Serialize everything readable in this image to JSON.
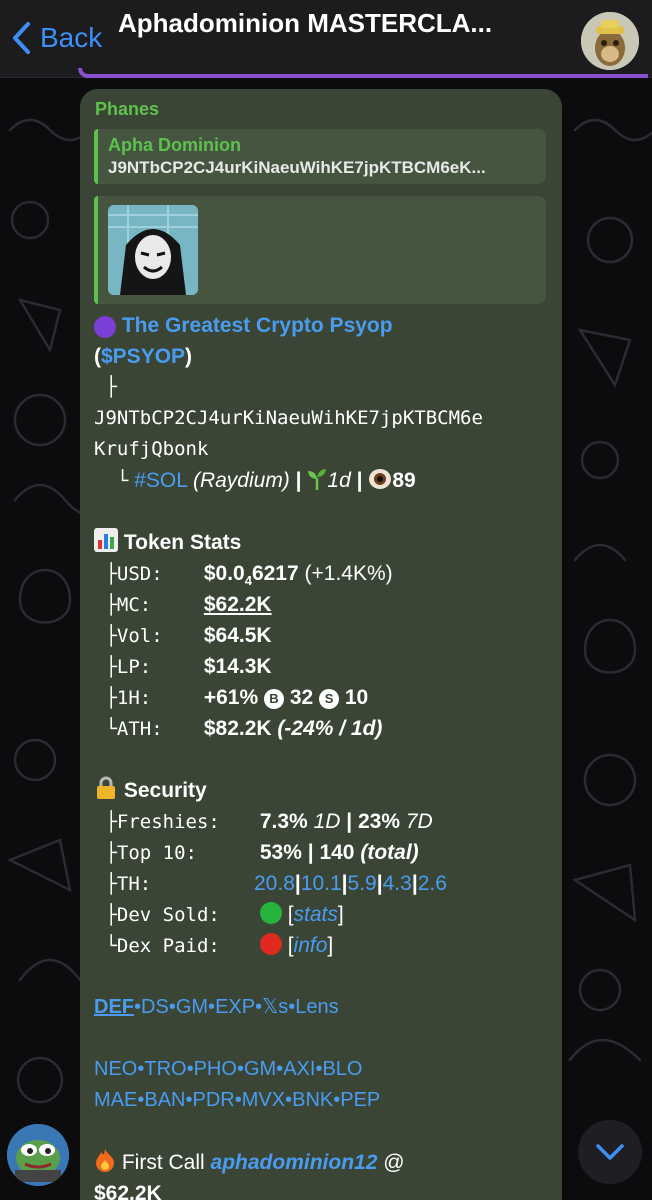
{
  "header": {
    "back_label": "Back",
    "title": "Aphadominion MASTERCLA..."
  },
  "message": {
    "sender": "Phanes",
    "reply": {
      "name": "Apha Dominion",
      "text": "J9NTbCP2CJ4urKiNaeuWihKE7jpKTBCM6eK..."
    },
    "token_title": "The Greatest Crypto Psyop",
    "ticker_open": "(",
    "ticker": "$PSYOP",
    "ticker_close": ")",
    "branch_tee": "├",
    "address_line1": "J9NTbCP2CJ4urKiNaeuWihKE7jpKTBCM6e",
    "address_line2": "KrufjQbonk",
    "branch_end": "└",
    "chain_tag": "#SOL",
    "dex": "(Raydium)",
    "sep": "|",
    "age": "1d",
    "views": "89",
    "stats": {
      "heading": "Token Stats",
      "usd_key": "├USD:",
      "usd_val_a": "$0.0",
      "usd_val_sub": "4",
      "usd_val_b": "6217",
      "usd_change": "(+1.4K%)",
      "mc_key": "├MC:",
      "mc_val": "$62.2K",
      "vol_key": "├Vol:",
      "vol_val": "$64.5K",
      "lp_key": "├LP:",
      "lp_val": "$14.3K",
      "h1_key": "├1H:",
      "h1_val": "+61%",
      "buy_icon": "B",
      "buys": "32",
      "sell_icon": "S",
      "sells": "10",
      "ath_key": "└ATH:",
      "ath_val": "$82.2K",
      "ath_change": "(-24% / 1d)"
    },
    "security": {
      "heading": "Security",
      "freshies_key": "├Freshies:",
      "freshies_1d": "7.3%",
      "freshies_1d_label": "1D",
      "sep": "|",
      "freshies_7d": "23%",
      "freshies_7d_label": "7D",
      "top10_key": "├Top 10:",
      "top10_pct": "53%",
      "top10_total": "140",
      "top10_total_label": "(total)",
      "th_key": "├TH:",
      "holders": [
        "20.8",
        "10.1",
        "5.9",
        "4.3",
        "2.6"
      ],
      "dev_sold_key": "├Dev Sold:",
      "dev_sold_link": "stats",
      "dex_paid_key": "└Dex Paid:",
      "dex_paid_link": "info",
      "bracket_open": "[",
      "bracket_close": "]"
    },
    "links_row1": [
      "DEF",
      "DS",
      "GM",
      "EXP",
      "𝕏s",
      "Lens"
    ],
    "links_row2": [
      "NEO",
      "TRO",
      "PHO",
      "GM",
      "AXI",
      "BLO"
    ],
    "links_row3": [
      "MAE",
      "BAN",
      "PDR",
      "MVX",
      "BNK",
      "PEP"
    ],
    "link_sep": "•",
    "first_call_label": "First Call",
    "first_call_user": "aphadominion12",
    "first_call_at": "@",
    "first_call_value": "$62.2K"
  },
  "colors": {
    "accent": "#3d8ff5",
    "bubble": "#3a4536",
    "sender_green": "#5ec14d",
    "link": "#4a9cf0",
    "pinned_bar": "#8a4fd0",
    "dev_sold_dot": "#27b43e",
    "dex_paid_dot": "#e02a1f"
  },
  "icons": {
    "back": "chevron-left-icon",
    "token": "purple-circle-icon",
    "age": "seedling-icon",
    "views": "eye-icon",
    "stats": "bar-chart-icon",
    "security": "lock-icon",
    "first_call": "fire-icon",
    "scroll": "chevron-down-icon"
  }
}
